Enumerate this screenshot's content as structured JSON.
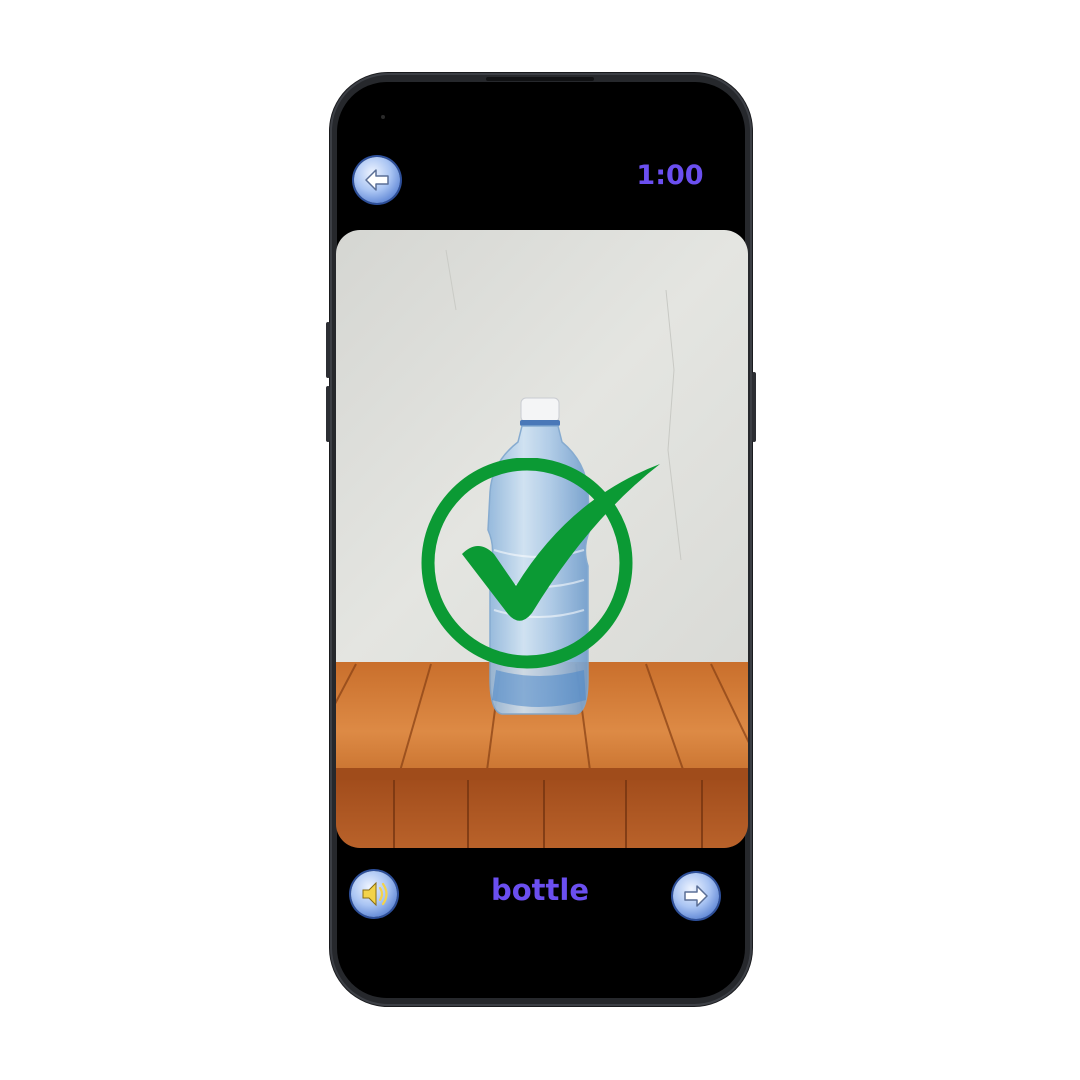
{
  "timer": {
    "text": "1:00"
  },
  "word": {
    "text": "bottle"
  },
  "buttons": {
    "back": {
      "icon": "arrow-left-icon"
    },
    "sound": {
      "icon": "speaker-icon"
    },
    "next": {
      "icon": "arrow-right-icon"
    }
  },
  "result": {
    "icon": "checkmark-circle-icon",
    "status": "correct",
    "color": "#0b9a34"
  },
  "colors": {
    "accent": "#6b4ff0",
    "screen": "#000000",
    "button": "#7aa0e6"
  }
}
